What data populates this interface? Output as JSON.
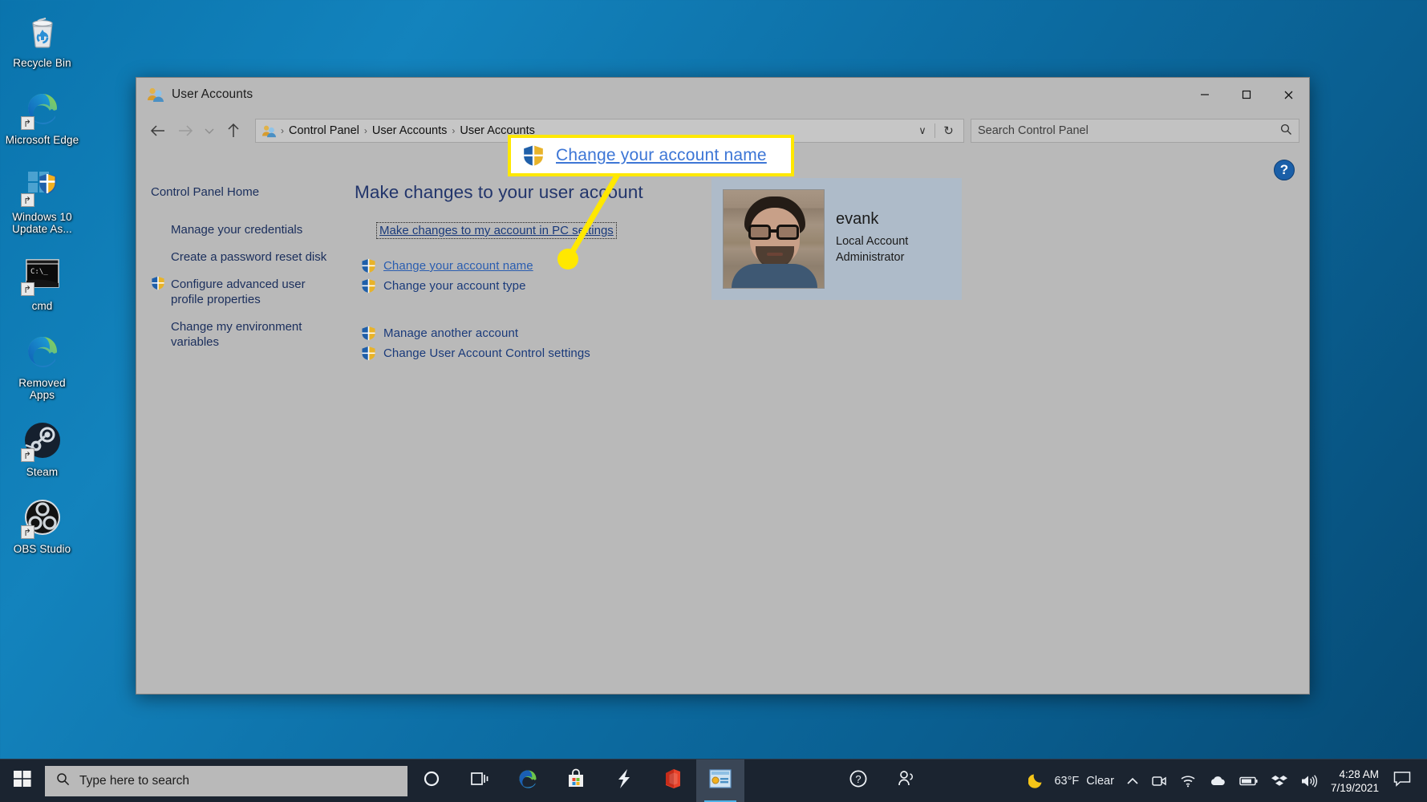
{
  "desktop": {
    "icons": [
      {
        "name": "recycle-bin",
        "label": "Recycle Bin"
      },
      {
        "name": "microsoft-edge",
        "label": "Microsoft Edge"
      },
      {
        "name": "windows-10-update",
        "label": "Windows 10 Update As..."
      },
      {
        "name": "cmd",
        "label": "cmd"
      },
      {
        "name": "removed-apps",
        "label": "Removed Apps"
      },
      {
        "name": "steam",
        "label": "Steam"
      },
      {
        "name": "obs-studio",
        "label": "OBS Studio"
      }
    ]
  },
  "window": {
    "title": "User Accounts",
    "icon": "user-accounts-icon",
    "controls": {
      "minimize": "─",
      "maximize": "□",
      "close": "✕"
    },
    "nav": {
      "back": "←",
      "forward": "→",
      "recent": "∨",
      "up": "↑"
    },
    "breadcrumb": {
      "items": [
        "Control Panel",
        "User Accounts",
        "User Accounts"
      ],
      "separator": "›",
      "dropdown": "∨",
      "refresh": "↻"
    },
    "search": {
      "placeholder": "Search Control Panel",
      "icon": "search-icon"
    },
    "help": {
      "label": "?",
      "name": "help-button"
    }
  },
  "sidebar": {
    "home": "Control Panel Home",
    "items": [
      {
        "label": "Manage your credentials",
        "shield": false
      },
      {
        "label": "Create a password reset disk",
        "shield": false
      },
      {
        "label": "Configure advanced user profile properties",
        "shield": true
      },
      {
        "label": "Change my environment variables",
        "shield": false
      }
    ]
  },
  "content": {
    "heading": "Make changes to your user account",
    "pc_settings_link": "Make changes to my account in PC settings",
    "tasks_primary": [
      {
        "label": "Change your account name",
        "shield": true,
        "hovered": true
      },
      {
        "label": "Change your account type",
        "shield": true,
        "hovered": false
      }
    ],
    "tasks_secondary": [
      {
        "label": "Manage another account",
        "shield": true
      },
      {
        "label": "Change User Account Control settings",
        "shield": true
      }
    ],
    "account": {
      "username": "evank",
      "type": "Local Account",
      "role": "Administrator",
      "photo_alt": "account-picture"
    }
  },
  "annotation": {
    "callout_text": "Change your account name",
    "callout_shield": "uac-shield-icon",
    "border_color": "#ffe800",
    "line_color": "#ffe800",
    "link_color": "#3d76d6"
  },
  "taskbar": {
    "start": "windows-logo-icon",
    "search_placeholder": "Type here to search",
    "search_icon": "search-icon",
    "apps": [
      {
        "name": "cortana",
        "label": "Cortana",
        "active": false
      },
      {
        "name": "task-view",
        "label": "Task View",
        "active": false
      },
      {
        "name": "microsoft-edge",
        "label": "Microsoft Edge",
        "active": false
      },
      {
        "name": "microsoft-store",
        "label": "Microsoft Store",
        "active": false
      },
      {
        "name": "sharex",
        "label": "ShareX",
        "active": false
      },
      {
        "name": "microsoft-office",
        "label": "Microsoft Office",
        "active": false
      },
      {
        "name": "control-panel",
        "label": "Control Panel",
        "active": true
      }
    ],
    "center_icons": [
      {
        "name": "help-circle",
        "label": "Get Help"
      },
      {
        "name": "people",
        "label": "People"
      }
    ],
    "tray": {
      "weather_icon": "moon-icon",
      "temperature": "63°F",
      "condition": "Clear",
      "chevron": "∧",
      "icons": [
        "meet-now-icon",
        "wifi-icon",
        "onedrive-icon",
        "battery-icon",
        "dropbox-icon",
        "volume-icon"
      ]
    },
    "clock": {
      "time": "4:28 AM",
      "date": "7/19/2021"
    },
    "action_center": "action-center-icon"
  }
}
